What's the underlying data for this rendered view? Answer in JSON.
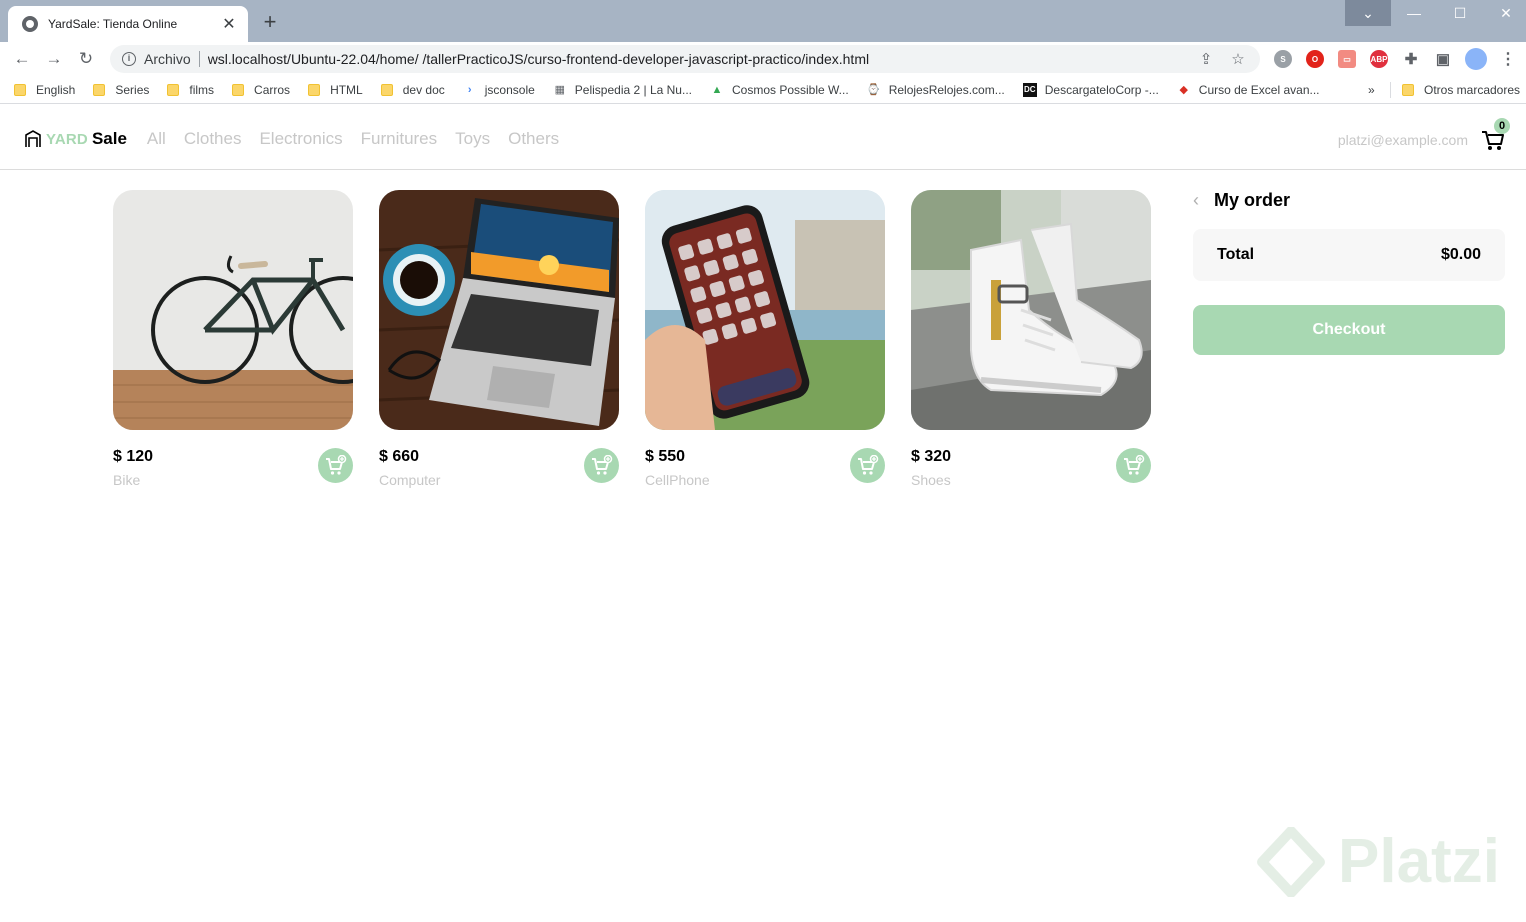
{
  "browser": {
    "tab_title": "YardSale: Tienda Online",
    "omnibox_label": "Archivo",
    "url": "wsl.localhost/Ubuntu-22.04/home/ /tallerPracticoJS/curso-frontend-developer-javascript-practico/index.html",
    "bookmarks": [
      {
        "label": "English",
        "icon": "folder-icon"
      },
      {
        "label": "Series",
        "icon": "folder-icon"
      },
      {
        "label": "films",
        "icon": "folder-icon"
      },
      {
        "label": "Carros",
        "icon": "folder-icon"
      },
      {
        "label": "HTML",
        "icon": "folder-icon"
      },
      {
        "label": "dev doc",
        "icon": "folder-icon"
      },
      {
        "label": "jsconsole",
        "icon": "chevron-icon"
      },
      {
        "label": "Pelispedia 2 | La Nu...",
        "icon": "film-icon"
      },
      {
        "label": "Cosmos Possible W...",
        "icon": "drive-icon"
      },
      {
        "label": "RelojesRelojes.com...",
        "icon": "watch-icon"
      },
      {
        "label": "DescargateloCorp -...",
        "icon": "dc-icon"
      },
      {
        "label": "Curso de Excel avan...",
        "icon": "excel-icon"
      }
    ],
    "bookmarks_more": "»",
    "other_bookmarks": "Otros marcadores",
    "extension_badges": {
      "opera": "O",
      "abp": "ABP"
    }
  },
  "app": {
    "logo_yard": "YARD",
    "logo_sale": "Sale",
    "nav": [
      "All",
      "Clothes",
      "Electronics",
      "Furnitures",
      "Toys",
      "Others"
    ],
    "email": "platzi@example.com",
    "cart_count": "0",
    "brand_color": "#a8d8b2",
    "products": [
      {
        "price": "$ 120",
        "name": "Bike",
        "image": "bike-image"
      },
      {
        "price": "$ 660",
        "name": "Computer",
        "image": "laptop-image"
      },
      {
        "price": "$ 550",
        "name": "CellPhone",
        "image": "phone-image"
      },
      {
        "price": "$ 320",
        "name": "Shoes",
        "image": "shoes-image"
      }
    ],
    "order": {
      "title": "My order",
      "total_label": "Total",
      "total_value": "$0.00",
      "checkout_label": "Checkout"
    }
  },
  "watermark": "Platzi"
}
